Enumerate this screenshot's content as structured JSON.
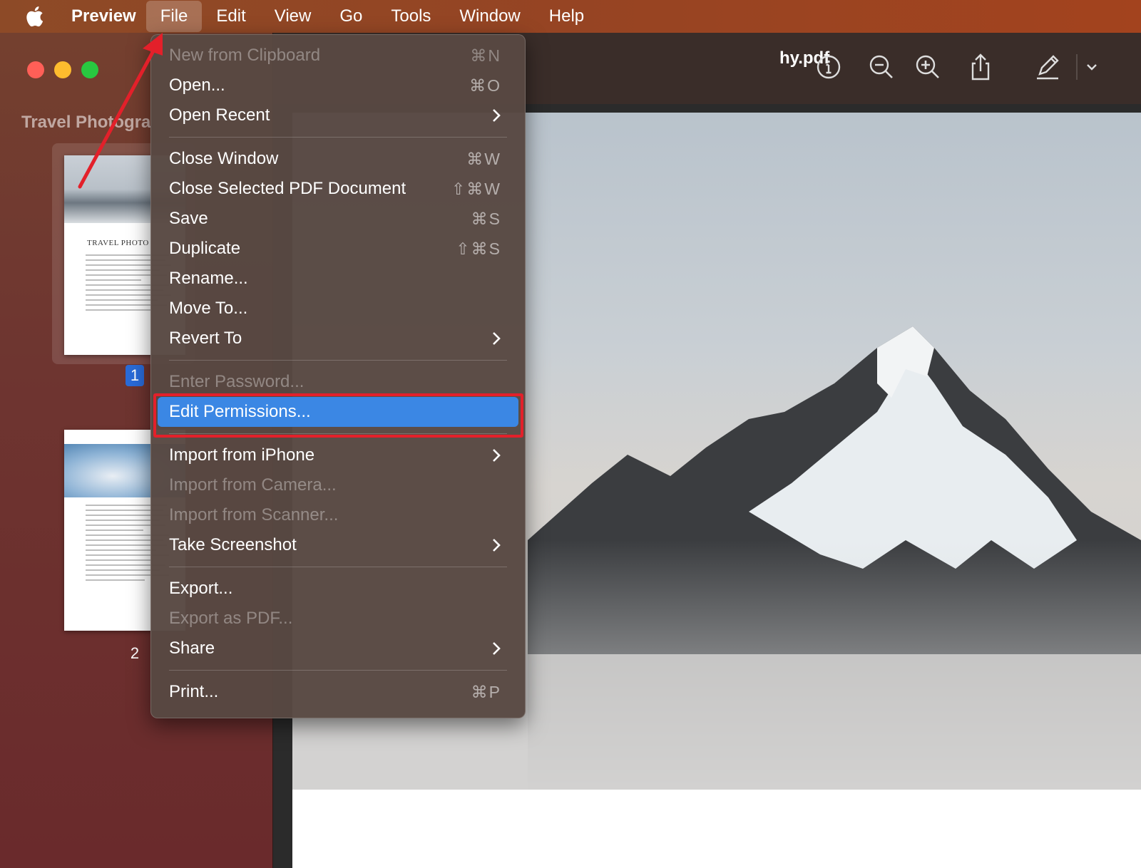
{
  "menubar": {
    "app_name": "Preview",
    "menus": [
      "File",
      "Edit",
      "View",
      "Go",
      "Tools",
      "Window",
      "Help"
    ],
    "active_menu": "File"
  },
  "window": {
    "title_visible": "hy.pdf",
    "sidebar_title": "Travel Photogra",
    "thumbnail_1_heading": "TRAVEL PHOTO",
    "pages": [
      "1",
      "2"
    ],
    "selected_page": "1",
    "toolbar_icons": [
      "info-icon",
      "zoom-out-icon",
      "zoom-in-icon",
      "share-icon",
      "markup-pen-icon",
      "chevron-down-icon"
    ]
  },
  "file_menu": {
    "items": [
      {
        "label": "New from Clipboard",
        "shortcut": "⌘N",
        "disabled": true
      },
      {
        "label": "Open...",
        "shortcut": "⌘O"
      },
      {
        "label": "Open Recent",
        "submenu": true
      },
      {
        "separator": true
      },
      {
        "label": "Close Window",
        "shortcut": "⌘W"
      },
      {
        "label": "Close Selected PDF Document",
        "shortcut": "⇧⌘W"
      },
      {
        "label": "Save",
        "shortcut": "⌘S"
      },
      {
        "label": "Duplicate",
        "shortcut": "⇧⌘S"
      },
      {
        "label": "Rename..."
      },
      {
        "label": "Move To..."
      },
      {
        "label": "Revert To",
        "submenu": true
      },
      {
        "separator": true
      },
      {
        "label": "Enter Password...",
        "disabled": true
      },
      {
        "label": "Edit Permissions...",
        "highlighted": true
      },
      {
        "separator": true
      },
      {
        "label": "Import from iPhone",
        "submenu": true
      },
      {
        "label": "Import from Camera...",
        "disabled": true
      },
      {
        "label": "Import from Scanner...",
        "disabled": true
      },
      {
        "label": "Take Screenshot",
        "submenu": true
      },
      {
        "separator": true
      },
      {
        "label": "Export..."
      },
      {
        "label": "Export as PDF...",
        "disabled": true
      },
      {
        "label": "Share",
        "submenu": true
      },
      {
        "separator": true
      },
      {
        "label": "Print...",
        "shortcut": "⌘P"
      }
    ]
  },
  "colors": {
    "highlight": "#3b87e4",
    "annotation_red": "#e3202a",
    "selected_page_badge": "#2a6bd8"
  }
}
